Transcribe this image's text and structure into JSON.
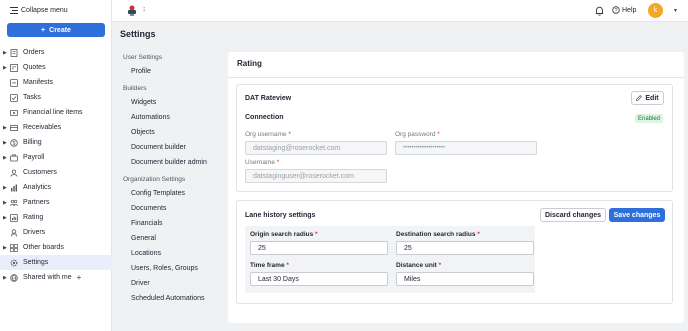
{
  "sidebar": {
    "collapse_label": "Collapse menu",
    "create_label": "Create",
    "items": [
      {
        "label": "Orders",
        "icon": "orders-icon",
        "expandable": true
      },
      {
        "label": "Quotes",
        "icon": "quotes-icon",
        "expandable": true
      },
      {
        "label": "Manifests",
        "icon": "manifests-icon",
        "expandable": false
      },
      {
        "label": "Tasks",
        "icon": "tasks-icon",
        "expandable": false
      },
      {
        "label": "Financial line items",
        "icon": "financial-icon",
        "expandable": false
      },
      {
        "label": "Receivables",
        "icon": "receivables-icon",
        "expandable": true
      },
      {
        "label": "Billing",
        "icon": "billing-icon",
        "expandable": true
      },
      {
        "label": "Payroll",
        "icon": "payroll-icon",
        "expandable": true
      },
      {
        "label": "Customers",
        "icon": "customers-icon",
        "expandable": false
      },
      {
        "label": "Analytics",
        "icon": "analytics-icon",
        "expandable": true
      },
      {
        "label": "Partners",
        "icon": "partners-icon",
        "expandable": true
      },
      {
        "label": "Rating",
        "icon": "rating-icon",
        "expandable": true
      },
      {
        "label": "Drivers",
        "icon": "drivers-icon",
        "expandable": false
      },
      {
        "label": "Other boards",
        "icon": "boards-icon",
        "expandable": true
      },
      {
        "label": "Settings",
        "icon": "settings-icon",
        "expandable": false,
        "active": true
      },
      {
        "label": "Shared with me",
        "icon": "shared-icon",
        "expandable": true
      }
    ]
  },
  "topbar": {
    "help_label": "Help",
    "avatar_initial": "k",
    "accent": "#f5a623"
  },
  "page": {
    "title": "Settings"
  },
  "settings_nav": {
    "user_settings": {
      "heading": "User Settings",
      "items": [
        "Profile"
      ]
    },
    "builders": {
      "heading": "Builders",
      "items": [
        "Widgets",
        "Automations",
        "Objects",
        "Document builder",
        "Document builder admin"
      ]
    },
    "organization_settings": {
      "heading": "Organization Settings",
      "items": [
        "Config Templates",
        "Documents",
        "Financials",
        "General",
        "Locations",
        "Users, Roles, Groups",
        "Driver",
        "Scheduled Automations"
      ]
    }
  },
  "rating": {
    "title": "Rating",
    "dat": {
      "title": "DAT Rateview",
      "edit_label": "Edit",
      "connection_label": "Connection",
      "status": "Enabled",
      "org_username_label": "Org username",
      "org_username_value": "datstaging@roserocket.com",
      "org_password_label": "Org password",
      "org_password_value": "••••••••••••••••••••",
      "username_label": "Username",
      "username_value": "datstaginguser@roserocket.com"
    },
    "lane": {
      "title": "Lane history settings",
      "discard_label": "Discard changes",
      "save_label": "Save changes",
      "origin_radius_label": "Origin search radius",
      "origin_radius_value": "25",
      "destination_radius_label": "Destination search radius",
      "destination_radius_value": "25",
      "time_frame_label": "Time frame",
      "time_frame_value": "Last 30 Days",
      "distance_unit_label": "Distance unit",
      "distance_unit_value": "Miles"
    }
  },
  "colors": {
    "primary": "#2f6fdb",
    "enabled_bg": "#dff3e4",
    "enabled_text": "#1f7a3a"
  }
}
